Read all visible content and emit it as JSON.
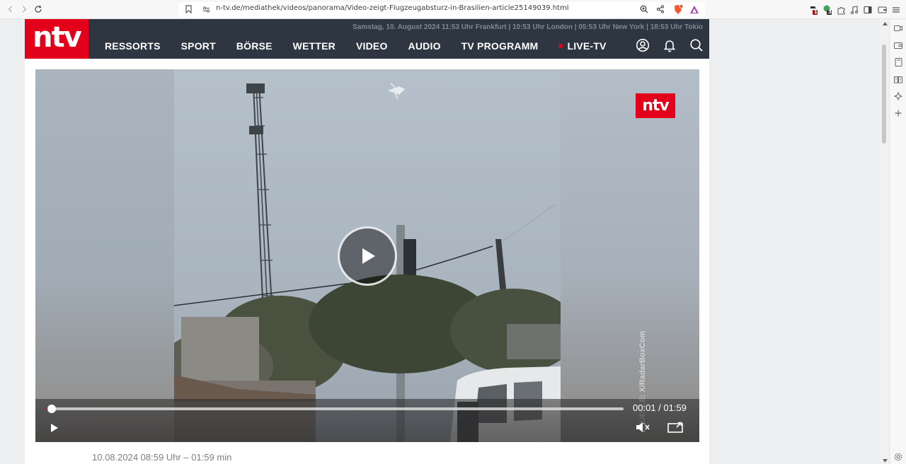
{
  "browser": {
    "url": "n-tv.de/mediathek/videos/panorama/Video-zeigt-Flugzeugabsturz-in-Brasilien-article25149039.html",
    "extension_badges": [
      "1",
      "3"
    ]
  },
  "site": {
    "logo": "ntv",
    "dateline": "Samstag, 10. August 2024 11:53 Uhr Frankfurt | 10:53 Uhr London | 05:53 Uhr New York | 18:53 Uhr Tokio",
    "nav": [
      "RESSORTS",
      "SPORT",
      "BÖRSE",
      "WETTER",
      "VIDEO",
      "AUDIO",
      "TV PROGRAMM",
      "LIVE-TV"
    ],
    "header_icons": [
      "user-icon",
      "bell-icon",
      "search-icon"
    ]
  },
  "video": {
    "badge": "ntv",
    "source": "QUELLE: X/RadarBoxCom",
    "current_time": "00:01",
    "duration": "01:59",
    "time_display": "00:01 / 01:59",
    "progress": 0.01,
    "accent": "#e2001a"
  },
  "meta": {
    "date_duration": "10.08.2024 08:59 Uhr – 01:59 min"
  }
}
